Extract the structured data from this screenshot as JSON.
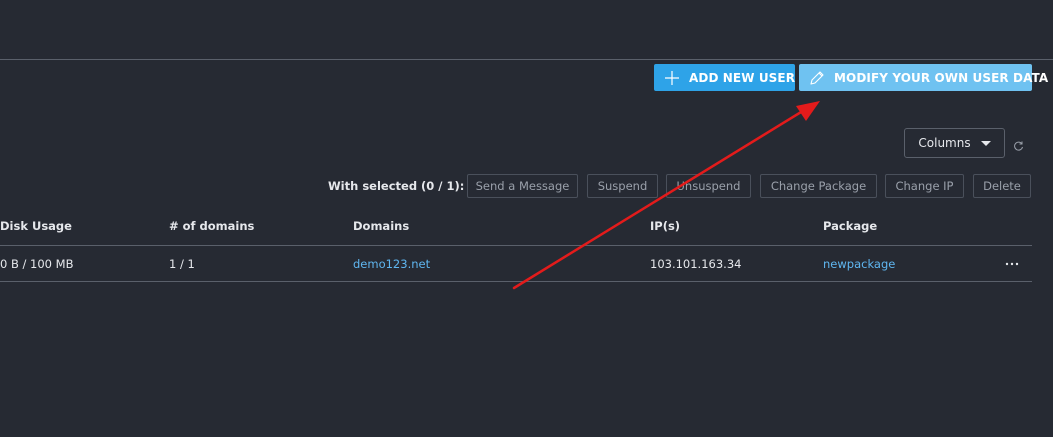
{
  "toolbar": {
    "add_user_label": "ADD NEW USER",
    "add_user_icon": "plus-icon",
    "modify_label": "MODIFY YOUR OWN USER DATA",
    "modify_icon": "pencil-icon",
    "add_color": "#2ea3e8",
    "modify_color": "#6fc2f1"
  },
  "columns_control": {
    "label": "Columns",
    "icon": "caret-down-icon",
    "refresh_icon": "refresh-icon"
  },
  "bulk_actions": {
    "label": "With selected (0 / 1):",
    "buttons": [
      "Send a Message",
      "Suspend",
      "Unsuspend",
      "Change Package",
      "Change IP",
      "Delete"
    ]
  },
  "table": {
    "columns": [
      "Disk Usage",
      "# of domains",
      "Domains",
      "IP(s)",
      "Package"
    ],
    "rows": [
      {
        "disk_usage": "0 B / 100 MB",
        "num_domains": "1 / 1",
        "domains": "demo123.net",
        "ips": "103.101.163.34",
        "package": "newpackage",
        "menu_icon": "more-horizontal-icon"
      }
    ],
    "link_color": "#5fb6f0"
  },
  "annotation": {
    "arrow_color": "#e31b1b"
  }
}
